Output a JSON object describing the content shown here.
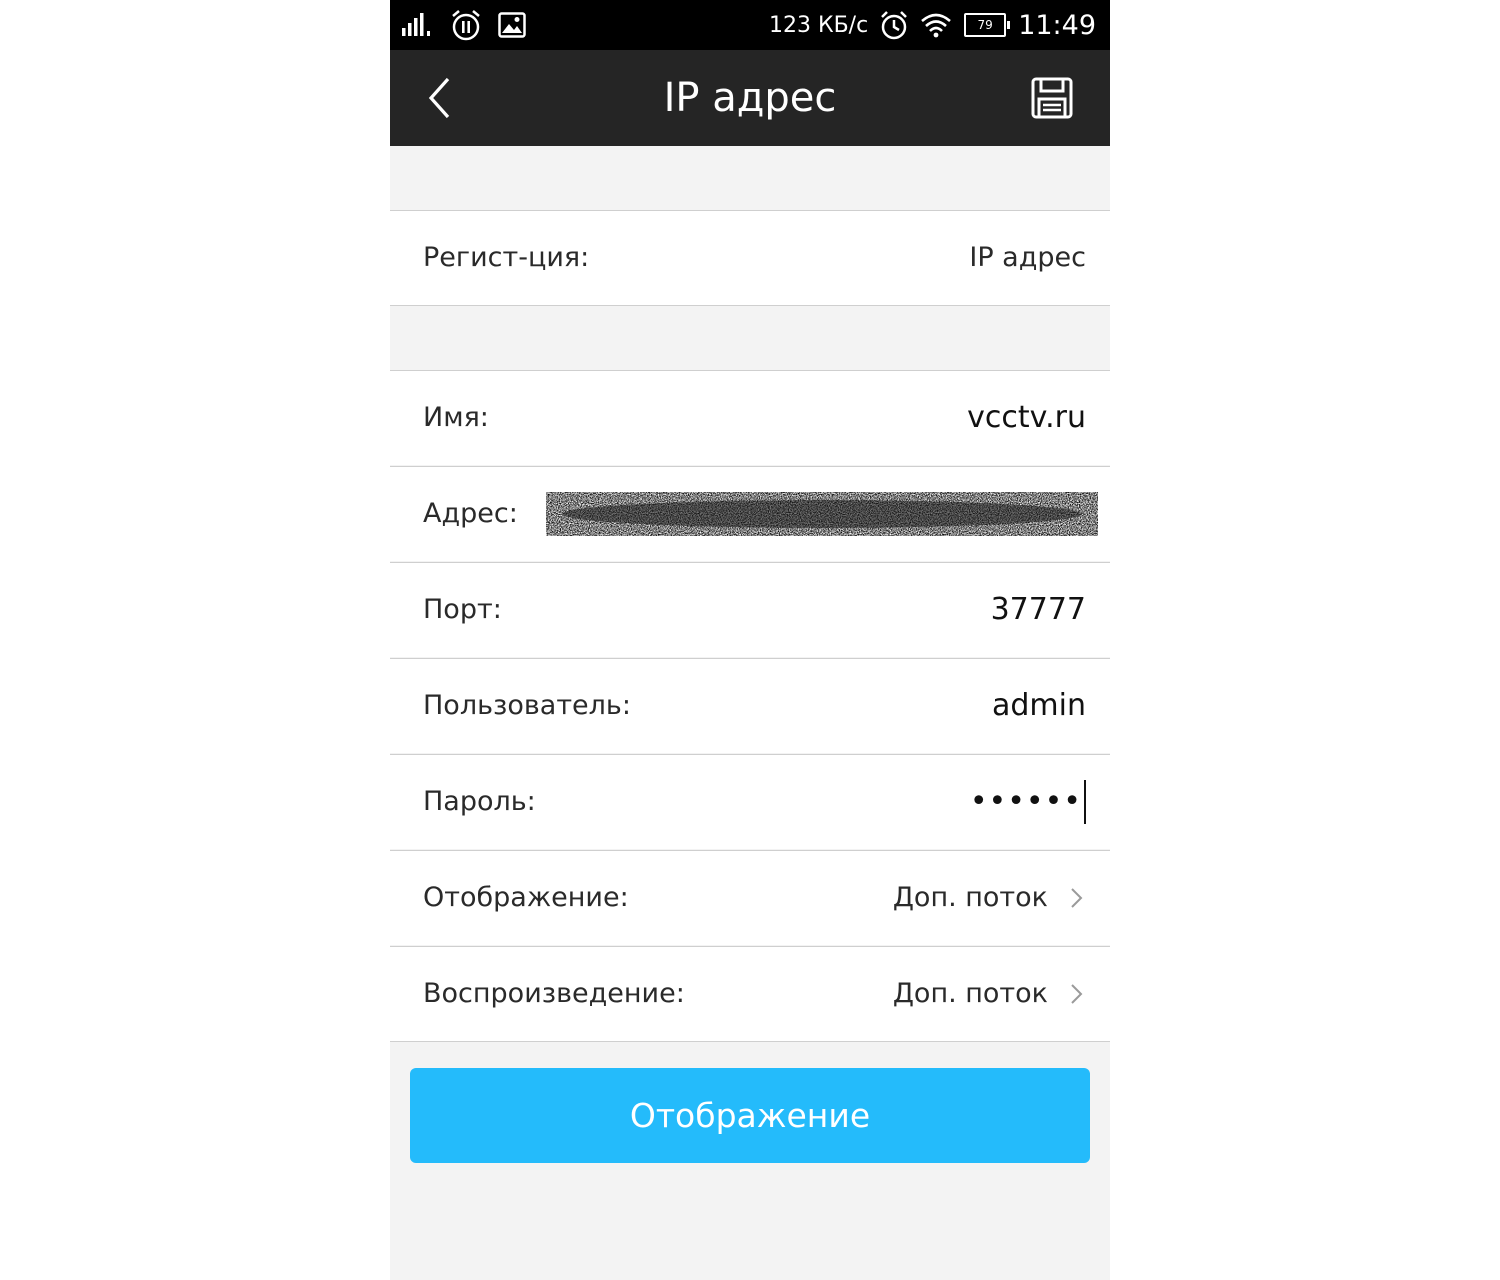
{
  "status_bar": {
    "network_speed": "123 КБ/с",
    "battery_level": "79",
    "time": "11:49",
    "icons": [
      "signal-icon",
      "alarm-app-icon",
      "image-notification-icon",
      "alarm-clock-icon",
      "wifi-icon",
      "battery-icon"
    ]
  },
  "header": {
    "title": "IP адрес",
    "back_icon": "chevron-left-icon",
    "save_icon": "save-icon"
  },
  "form": {
    "registration": {
      "label": "Регист-ция:",
      "value": "IP адрес"
    },
    "name": {
      "label": "Имя:",
      "value": "vcctv.ru"
    },
    "address": {
      "label": "Адрес:"
    },
    "port": {
      "label": "Порт:",
      "value": "37777"
    },
    "user": {
      "label": "Пользователь:",
      "value": "admin"
    },
    "password": {
      "label": "Пароль:",
      "value": "••••••"
    },
    "display": {
      "label": "Отображение:",
      "value": "Доп. поток"
    },
    "playback": {
      "label": "Воспроизведение:",
      "value": "Доп. поток"
    }
  },
  "primary_button": {
    "label": "Отображение"
  },
  "colors": {
    "status_bar_bg": "#000000",
    "header_bg": "#252525",
    "page_bg": "#f3f3f3",
    "button_bg": "#24bbfb"
  }
}
